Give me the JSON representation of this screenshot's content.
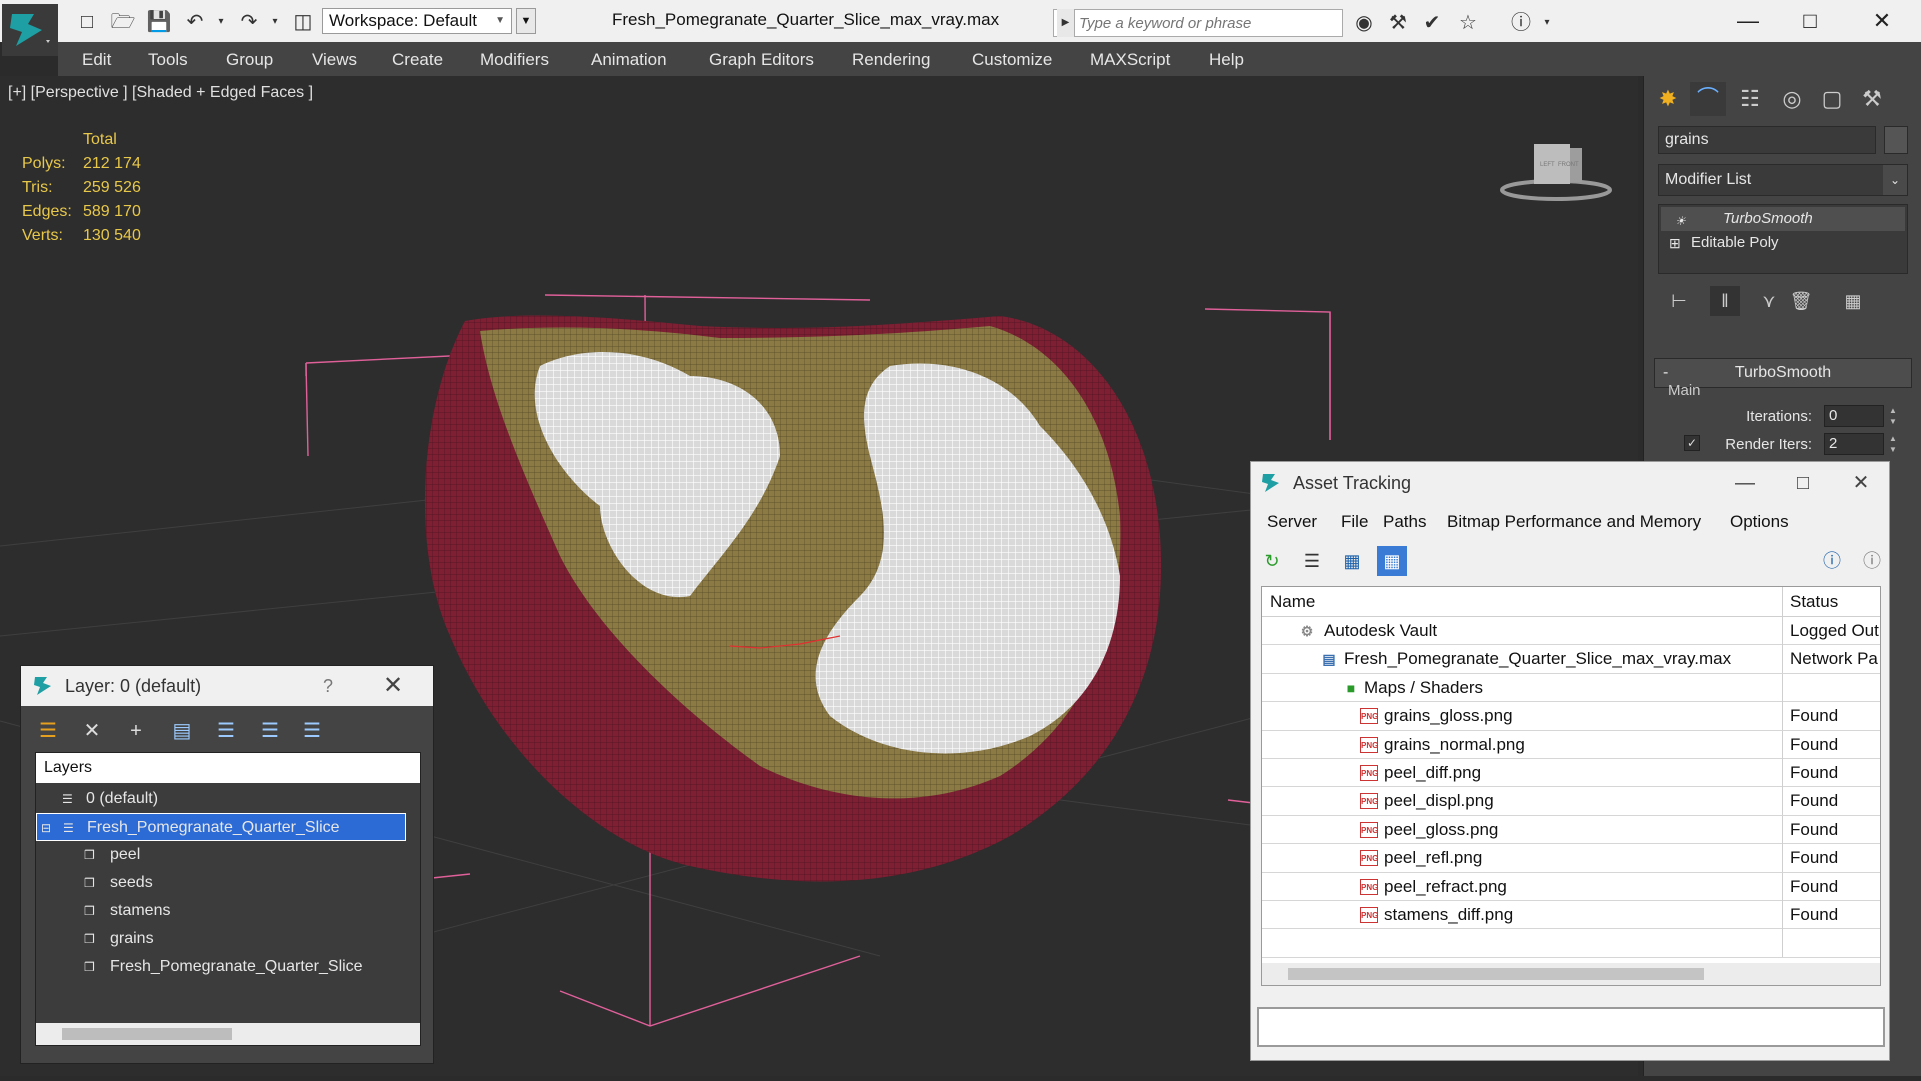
{
  "titlebar": {
    "workspace_label": "Workspace: Default",
    "document_title": "Fresh_Pomegranate_Quarter_Slice_max_vray.max",
    "search_placeholder": "Type a keyword or phrase"
  },
  "menubar": [
    "Edit",
    "Tools",
    "Group",
    "Views",
    "Create",
    "Modifiers",
    "Animation",
    "Graph Editors",
    "Rendering",
    "Customize",
    "MAXScript",
    "Help"
  ],
  "viewport": {
    "label": "[+] [Perspective ] [Shaded + Edged Faces ]",
    "stats_header": "Total",
    "stats": [
      {
        "label": "Polys:",
        "value": "212 174"
      },
      {
        "label": "Tris:",
        "value": "259 526"
      },
      {
        "label": "Edges:",
        "value": "589 170"
      },
      {
        "label": "Verts:",
        "value": "130 540"
      }
    ],
    "viewcube_left": "LEFT",
    "viewcube_front": "FRONT"
  },
  "command_panel": {
    "object_name": "grains",
    "modifier_list": "Modifier List",
    "stack": [
      {
        "label": "TurboSmooth",
        "italic": true
      },
      {
        "label": "Editable Poly",
        "italic": false
      }
    ],
    "rollout_title": "TurboSmooth",
    "main_label": "Main",
    "params": [
      {
        "label": "Iterations:",
        "value": "0"
      },
      {
        "label": "Render Iters:",
        "value": "2"
      }
    ]
  },
  "layer_window": {
    "title": "Layer: 0 (default)",
    "help": "?",
    "header": "Layers",
    "rows": [
      {
        "label": "0 (default)",
        "indent": 1,
        "type": "layer",
        "selected": false
      },
      {
        "label": "Fresh_Pomegranate_Quarter_Slice",
        "indent": 1,
        "type": "layer",
        "selected": true
      },
      {
        "label": "peel",
        "indent": 2,
        "type": "object",
        "selected": false
      },
      {
        "label": "seeds",
        "indent": 2,
        "type": "object",
        "selected": false
      },
      {
        "label": "stamens",
        "indent": 2,
        "type": "object",
        "selected": false
      },
      {
        "label": "grains",
        "indent": 2,
        "type": "object",
        "selected": false
      },
      {
        "label": "Fresh_Pomegranate_Quarter_Slice",
        "indent": 2,
        "type": "object",
        "selected": false
      }
    ]
  },
  "asset_window": {
    "title": "Asset Tracking",
    "menus": [
      "Server",
      "File",
      "Paths",
      "Bitmap Performance and Memory",
      "Options"
    ],
    "col_name": "Name",
    "col_status": "Status",
    "rows": [
      {
        "name": "Autodesk Vault",
        "status": "Logged Out",
        "indent": 0,
        "icon": "vault"
      },
      {
        "name": "Fresh_Pomegranate_Quarter_Slice_max_vray.max",
        "status": "Network Pa",
        "indent": 1,
        "icon": "max"
      },
      {
        "name": "Maps / Shaders",
        "status": "",
        "indent": 2,
        "icon": "maps"
      },
      {
        "name": "grains_gloss.png",
        "status": "Found",
        "indent": 3,
        "icon": "png"
      },
      {
        "name": "grains_normal.png",
        "status": "Found",
        "indent": 3,
        "icon": "png"
      },
      {
        "name": "peel_diff.png",
        "status": "Found",
        "indent": 3,
        "icon": "png"
      },
      {
        "name": "peel_displ.png",
        "status": "Found",
        "indent": 3,
        "icon": "png"
      },
      {
        "name": "peel_gloss.png",
        "status": "Found",
        "indent": 3,
        "icon": "png"
      },
      {
        "name": "peel_refl.png",
        "status": "Found",
        "indent": 3,
        "icon": "png"
      },
      {
        "name": "peel_refract.png",
        "status": "Found",
        "indent": 3,
        "icon": "png"
      },
      {
        "name": "stamens_diff.png",
        "status": "Found",
        "indent": 3,
        "icon": "png"
      }
    ],
    "png_badge": "PNG"
  },
  "colors": {
    "stats_text": "#e8c84a",
    "selection": "#2c6bd6",
    "bounding_box": "#e0609a",
    "peel": "#8a2436",
    "flesh": "#8c7a44"
  }
}
